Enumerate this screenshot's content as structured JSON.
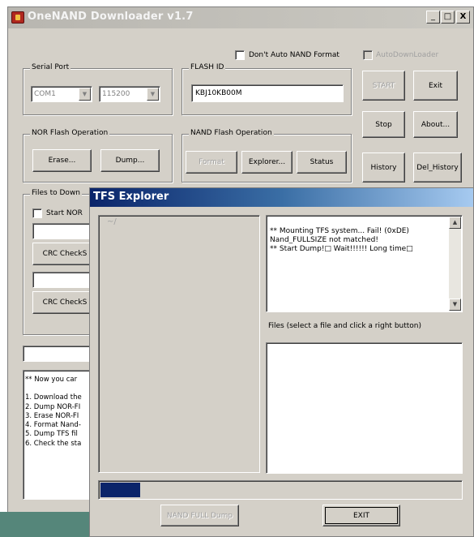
{
  "app": {
    "title": "OneNAND Downloader v1.7",
    "minimize": "_",
    "maximize": "□",
    "close": "X"
  },
  "top": {
    "dont_auto_format": "Don't Auto NAND Format",
    "auto_downloader": "AutoDownLoader"
  },
  "serial": {
    "label": "Serial Port",
    "port": "COM1",
    "baud": "115200"
  },
  "flash_id": {
    "label": "FLASH ID",
    "value": "KBJ10KB00M"
  },
  "right_buttons": {
    "start": "START",
    "exit": "Exit",
    "stop": "Stop",
    "about": "About...",
    "history": "History",
    "del_history": "Del_History"
  },
  "nor": {
    "label": "NOR Flash Operation",
    "erase": "Erase...",
    "dump": "Dump..."
  },
  "nand": {
    "label": "NAND Flash Operation",
    "format": "Format",
    "explorer": "Explorer...",
    "status": "Status"
  },
  "files_dl": {
    "label": "Files to Down",
    "start_nor": "Start NOR",
    "crc1": "CRC CheckS",
    "crc2": "CRC CheckS"
  },
  "log": {
    "lines": [
      "** Now you car",
      "",
      "1. Download the",
      "2. Dump NOR-FI",
      "3. Erase NOR-FI",
      "4. Format Nand-",
      "5. Dump TFS fil",
      "6. Check the sta"
    ]
  },
  "dialog": {
    "title": "TFS Explorer",
    "tree_root": "~/",
    "messages": [
      "** Mounting TFS system... Fail! (0xDE)",
      "Nand_FULLSIZE not matched!",
      "** Start Dump!□  Wait!!!!!! Long time□"
    ],
    "files_label": "Files  (select a file and click a right button)",
    "progress": 0.11,
    "nand_full_dump": "NAND FULL Dump",
    "exit": "EXIT"
  },
  "colors": {
    "dialog_title_start": "#0a246a",
    "dialog_title_end": "#a6caf0",
    "progress_fill": "#0a246a",
    "face": "#d4d0c8"
  }
}
